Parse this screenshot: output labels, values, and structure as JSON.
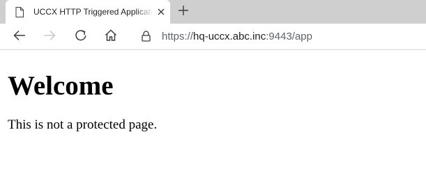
{
  "tab": {
    "title": "UCCX HTTP Triggered Application",
    "icon": "document-icon"
  },
  "address_bar": {
    "scheme": "https://",
    "host": "hq-uccx.abc.inc",
    "port_path": ":9443/app"
  },
  "page": {
    "heading": "Welcome",
    "paragraph": "This is not a protected page."
  },
  "colors": {
    "tabstrip_bg": "#cfcfcf",
    "icon_color": "#3c3c3c",
    "disabled_icon": "#c8c8c8"
  }
}
